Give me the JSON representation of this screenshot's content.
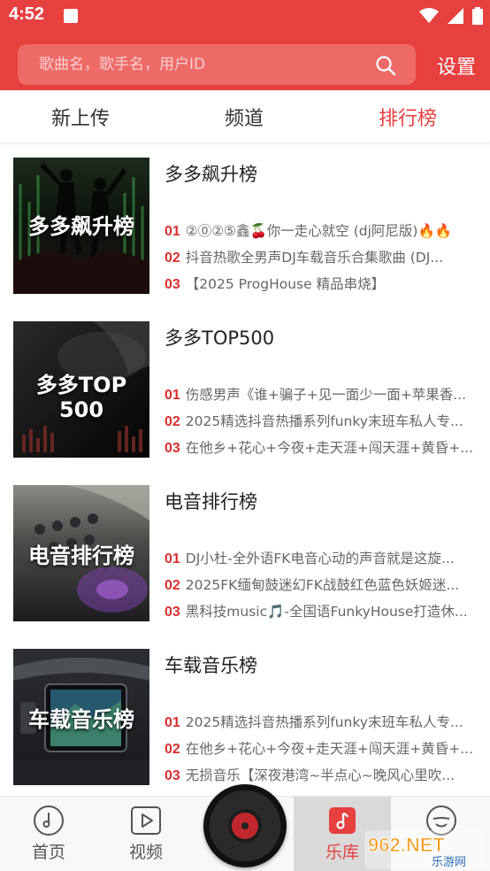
{
  "status_bar": {
    "time": "4:52"
  },
  "search": {
    "placeholder": "歌曲名，歌手名，用户ID",
    "value": "",
    "settings_label": "设置"
  },
  "tabs": [
    {
      "label": "新上传",
      "active": false
    },
    {
      "label": "频道",
      "active": false
    },
    {
      "label": "排行榜",
      "active": true
    }
  ],
  "charts": [
    {
      "name": "多多飙升榜",
      "cover_text": "多多飙升榜",
      "tracks": [
        {
          "rank": "01",
          "title": "②⓪②⑤鑫🍒你一走心就空 (dj阿尼版)🔥🔥"
        },
        {
          "rank": "02",
          "title": "抖音热歌全男声DJ车载音乐合集歌曲 (DJ..."
        },
        {
          "rank": "03",
          "title": "【2025 ProgHouse 精品串烧】"
        }
      ]
    },
    {
      "name": "多多TOP500",
      "cover_text_line1": "多多TOP",
      "cover_text_line2": "500",
      "tracks": [
        {
          "rank": "01",
          "title": "伤感男声《谁+骗子+见一面少一面+苹果香..."
        },
        {
          "rank": "02",
          "title": "2025精选抖音热播系列funky末班车私人专..."
        },
        {
          "rank": "03",
          "title": "在他乡+花心+今夜+走天涯+闯天涯+黄昏+..."
        }
      ]
    },
    {
      "name": "电音排行榜",
      "cover_text": "电音排行榜",
      "tracks": [
        {
          "rank": "01",
          "title": "DJ小杜-全外语FK电音心动的声音就是这旋..."
        },
        {
          "rank": "02",
          "title": "2025FK缅甸鼓迷幻FK战鼓红色蓝色妖姬迷..."
        },
        {
          "rank": "03",
          "title": "黑科技music🎵-全国语FunkyHouse打造休..."
        }
      ]
    },
    {
      "name": "车载音乐榜",
      "cover_text": "车载音乐榜",
      "tracks": [
        {
          "rank": "01",
          "title": "2025精选抖音热播系列funky末班车私人专..."
        },
        {
          "rank": "02",
          "title": "在他乡+花心+今夜+走天涯+闯天涯+黄昏+..."
        },
        {
          "rank": "03",
          "title": "无损音乐【深夜港湾~半点心~晚风心里吹..."
        }
      ]
    }
  ],
  "bottom_nav": {
    "home": "首页",
    "video": "视频",
    "library": "乐库",
    "active": "library"
  },
  "watermark": {
    "text": "962.NET",
    "sub": "乐游网"
  },
  "colors": {
    "primary": "#e6403f",
    "rank": "#d8302e",
    "search_bg": "#ee6a67"
  }
}
